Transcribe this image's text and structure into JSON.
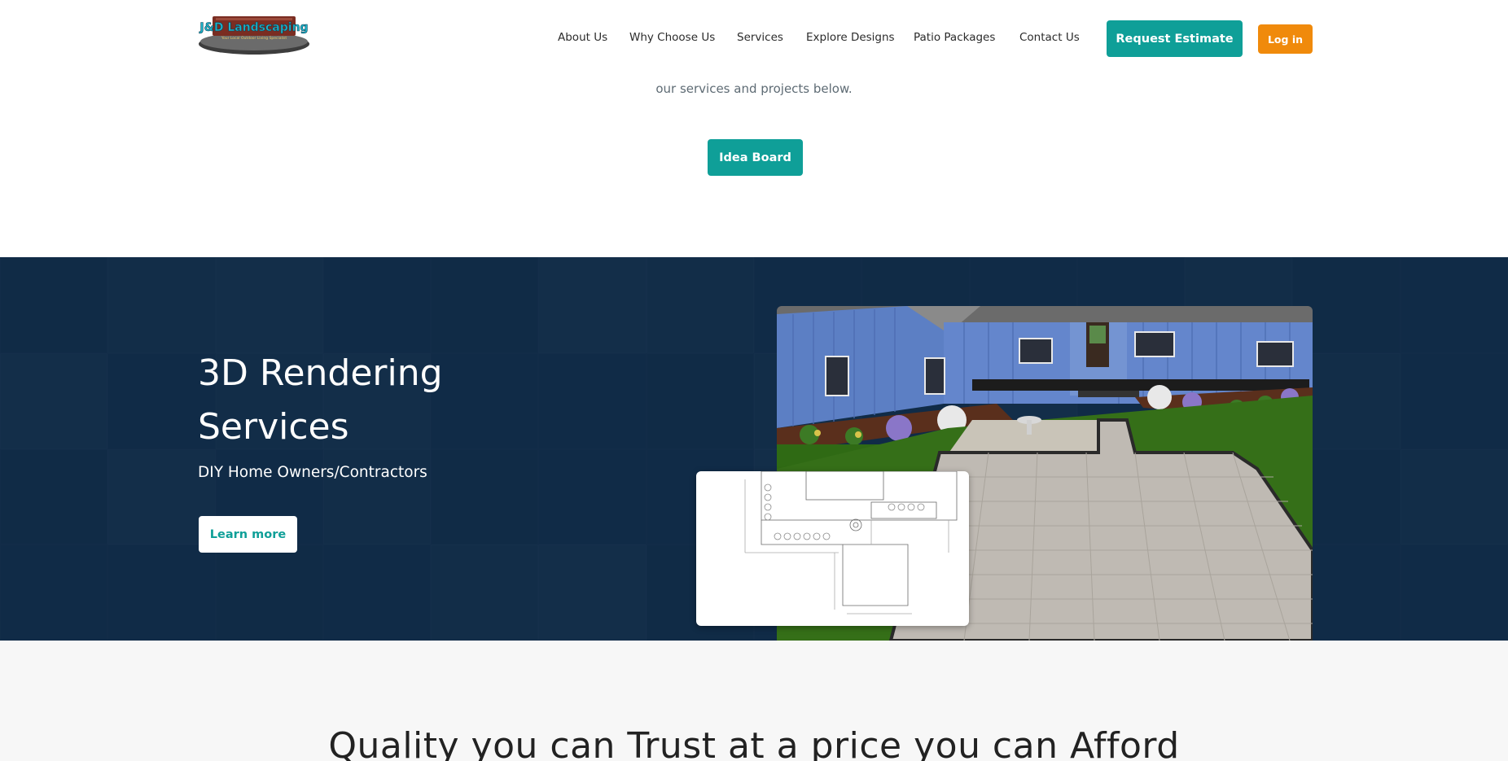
{
  "header": {
    "logo": {
      "text": "J&D Landscaping",
      "tagline": "Your Local Outdoor Living Specialist"
    },
    "nav": [
      {
        "label": "About Us"
      },
      {
        "label": "Why Choose Us"
      },
      {
        "label": "Services"
      },
      {
        "label": "Explore Designs"
      },
      {
        "label": "Patio Packages"
      },
      {
        "label": "Contact Us"
      }
    ],
    "request_estimate_label": "Request Estimate",
    "login_label": "Log in"
  },
  "intro": {
    "text": "our services and projects below.",
    "button_label": "Idea Board"
  },
  "rendering": {
    "title": "3D Rendering Services",
    "subtitle": "DIY Home Owners/Contractors",
    "button_label": "Learn more"
  },
  "quality": {
    "title": "Quality you can Trust at a price you can Afford"
  },
  "colors": {
    "teal": "#0f9f98",
    "orange": "#f08a0b",
    "navy": "#112b47",
    "house_blue": "#5c7fc4",
    "paver": "#bfbab3",
    "grass": "#2f6a14"
  }
}
